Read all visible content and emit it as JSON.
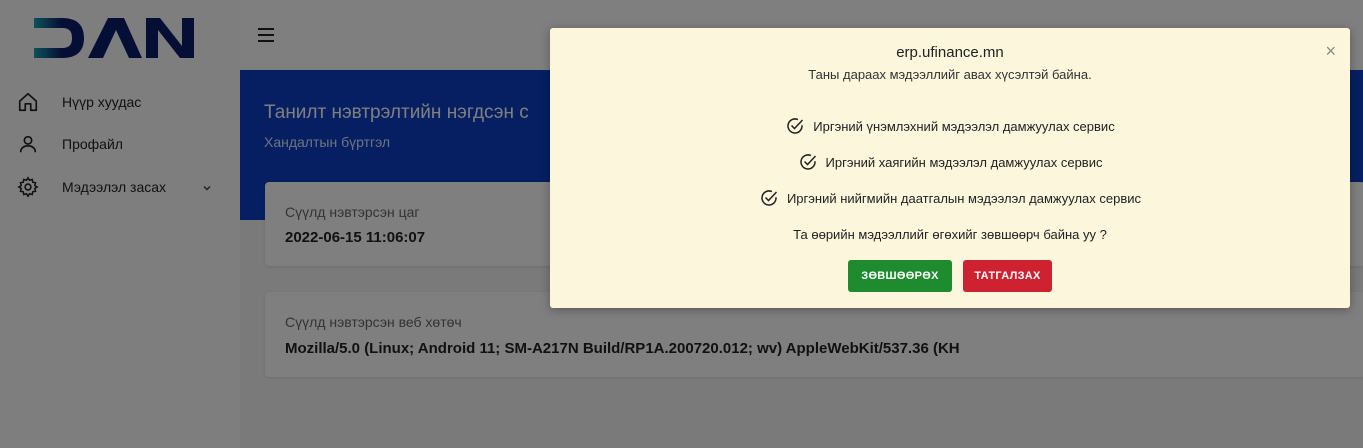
{
  "logo_text": "DAN",
  "nav": {
    "home": "Нүүр хуудас",
    "profile": "Профайл",
    "edit": "Мэдээлэл засах"
  },
  "icons": {
    "menu": "hamburger-menu-icon",
    "home": "home-icon",
    "profile": "user-icon",
    "edit": "gear-icon",
    "expand": "chevron-down-icon",
    "check": "check-circle-icon",
    "close": "close-icon"
  },
  "banner": {
    "title": "Танилт нэвтрэлтийн нэгдсэн с",
    "subtitle": "Хандалтын бүртгэл"
  },
  "cards": {
    "last_login_time_label": "Сүүлд нэвтэрсэн цаг",
    "last_login_time_value": "2022-06-15 11:06:07",
    "last_browser_label": "Сүүлд нэвтэрсэн веб хөтөч",
    "last_browser_value": "Mozilla/5.0 (Linux; Android 11; SM-A217N Build/RP1A.200720.012; wv) AppleWebKit/537.36 (KH"
  },
  "modal": {
    "domain": "erp.ufinance.mn",
    "request_text": "Таны дараах мэдээллийг авах хүсэлтэй байна.",
    "permissions": [
      "Иргэний үнэмлэхний мэдээлэл дамжуулах сервис",
      "Иргэний хаягийн мэдээлэл дамжуулах сервис",
      "Иргэний нийгмийн даатгалын мэдээлэл дамжуулах сервис"
    ],
    "question": "Та өөрийн мэдээллийг өгөхийг зөвшөөрч байна уу ?",
    "accept_label": "ЗӨВШӨӨРӨХ",
    "decline_label": "ТАТГАЛЗАХ",
    "close_symbol": "×"
  },
  "colors": {
    "banner": "#0a3fc4",
    "modal_bg": "#fbf6dc",
    "accept": "#1e8c2e",
    "decline": "#cf2230",
    "logo_dark": "#0b1f6b",
    "logo_teal": "#1aa3b3"
  }
}
